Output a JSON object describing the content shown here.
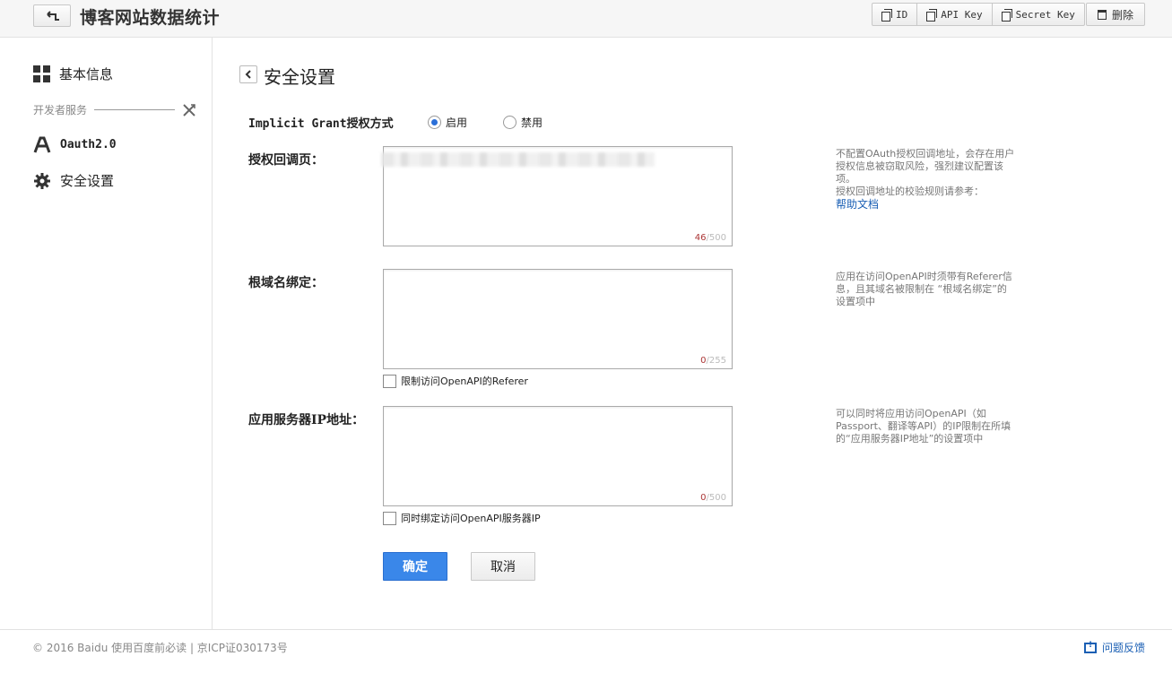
{
  "header": {
    "title": "博客网站数据统计",
    "btn_id": "ID",
    "btn_api_key": "API Key",
    "btn_secret_key": "Secret Key",
    "btn_delete": "删除"
  },
  "sidebar": {
    "basic_info": "基本信息",
    "dev_services": "开发者服务",
    "oauth": "Oauth2.0",
    "security": "安全设置"
  },
  "main": {
    "title": "安全设置",
    "grant_label": "Implicit Grant授权方式",
    "radio_enable": "启用",
    "radio_disable": "禁用",
    "callback": {
      "label": "授权回调页：",
      "count": "46",
      "max": "/500",
      "help_line1": "不配置OAuth授权回调地址，会存在用户授权信息被窃取风险，强烈建议配置该项。",
      "help_line2": "授权回调地址的校验规则请参考：",
      "help_link": "帮助文档"
    },
    "domain": {
      "label": "根域名绑定：",
      "count": "0",
      "max": "/255",
      "checkbox": "限制访问OpenAPI的Referer",
      "help": "应用在访问OpenAPI时须带有Referer信息，且其域名被限制在 “根域名绑定”的设置项中"
    },
    "ip": {
      "label": "应用服务器IP地址：",
      "count": "0",
      "max": "/500",
      "checkbox": "同时绑定访问OpenAPI服务器IP",
      "help": "可以同时将应用访问OpenAPI（如Passport、翻译等API）的IP限制在所填的“应用服务器IP地址”的设置项中"
    },
    "confirm": "确定",
    "cancel": "取消"
  },
  "footer": {
    "copyright": "© 2016 Baidu 使用百度前必读 | 京ICP证030173号",
    "feedback": "问题反馈"
  },
  "colors": {
    "primary": "#3a87e9",
    "link": "#1a5fb4"
  }
}
